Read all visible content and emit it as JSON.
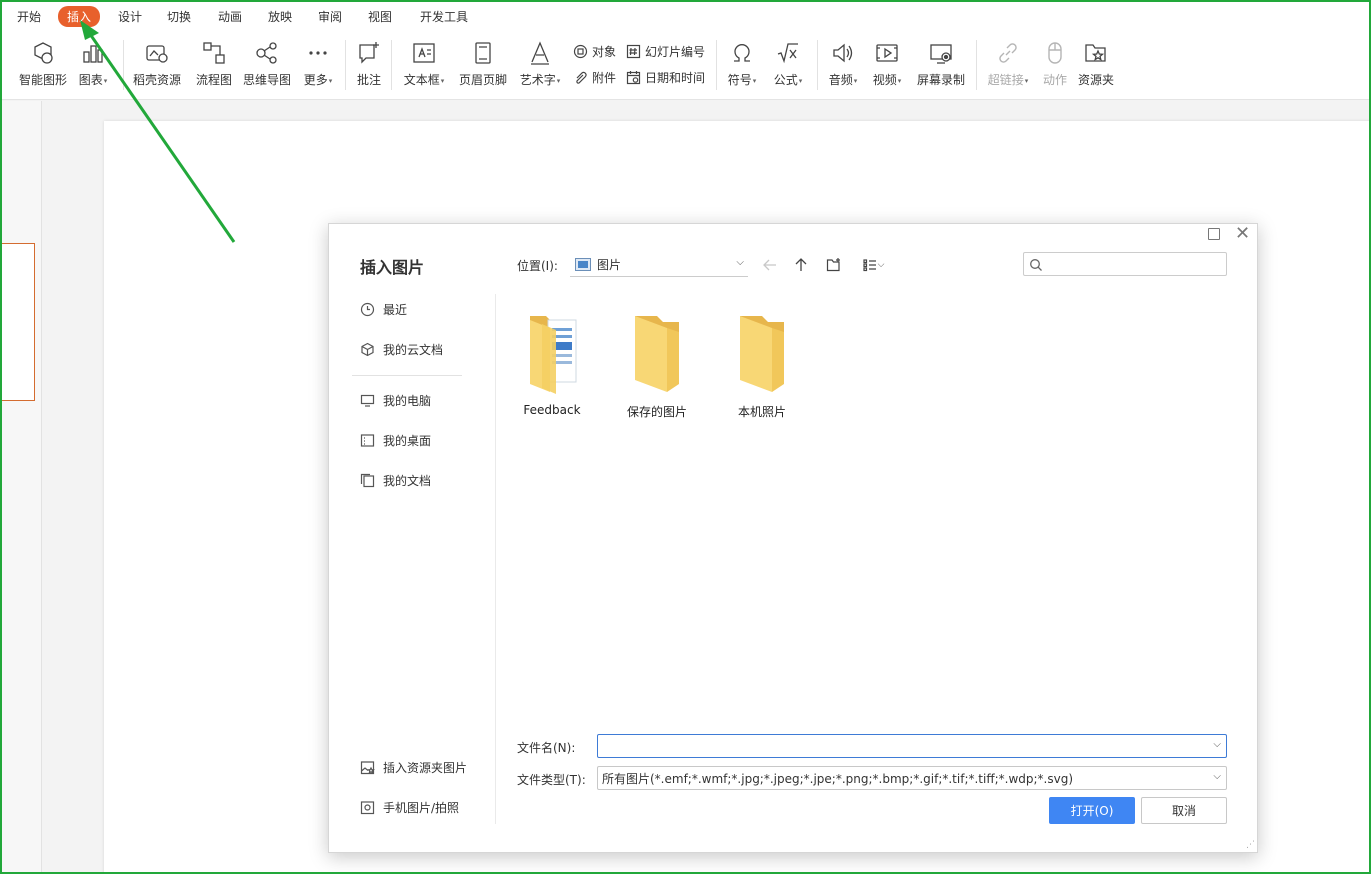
{
  "menu": {
    "items": [
      "开始",
      "插入",
      "设计",
      "切换",
      "动画",
      "放映",
      "审阅",
      "视图",
      "开发工具"
    ],
    "active_index": 1
  },
  "ribbon": {
    "smart_shape": "智能图形",
    "chart": "图表",
    "docer_resources": "稻壳资源",
    "flowchart": "流程图",
    "mindmap": "思维导图",
    "more": "更多",
    "comment": "批注",
    "textbox": "文本框",
    "header_footer": "页眉页脚",
    "wordart": "艺术字",
    "object": "对象",
    "attachment": "附件",
    "slide_number": "幻灯片编号",
    "date_time": "日期和时间",
    "symbol": "符号",
    "formula": "公式",
    "audio": "音频",
    "video": "视频",
    "screen_record": "屏幕录制",
    "hyperlink": "超链接",
    "action": "动作",
    "resource_folder": "资源夹"
  },
  "dialog": {
    "title": "插入图片",
    "sidebar": {
      "recent": "最近",
      "cloud_docs": "我的云文档",
      "my_computer": "我的电脑",
      "my_desktop": "我的桌面",
      "my_documents": "我的文档",
      "insert_from_library": "插入资源夹图片",
      "phone_photo": "手机图片/拍照"
    },
    "location_label": "位置(I):",
    "location_value": "图片",
    "search_placeholder": "",
    "folders": [
      "Feedback",
      "保存的图片",
      "本机照片"
    ],
    "filename_label": "文件名(N):",
    "filename_value": "",
    "filetype_label": "文件类型(T):",
    "filetype_value": "所有图片(*.emf;*.wmf;*.jpg;*.jpeg;*.jpe;*.png;*.bmp;*.gif;*.tif;*.tiff;*.wdp;*.svg)",
    "open_button": "打开(O)",
    "cancel_button": "取消"
  },
  "colors": {
    "active_tab": "#e8602c",
    "annotation_arrow": "#22a83a",
    "primary_button": "#3f86f3",
    "folder": "#f8d775"
  }
}
